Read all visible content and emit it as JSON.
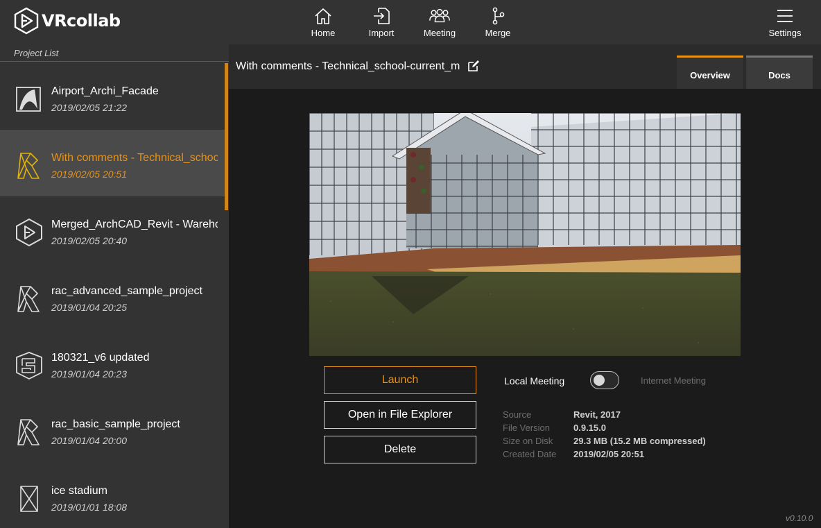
{
  "app": {
    "name": "VRcollab",
    "version": "v0.10.0"
  },
  "nav": {
    "home": "Home",
    "import": "Import",
    "meeting": "Meeting",
    "merge": "Merge",
    "settings": "Settings"
  },
  "sidebar": {
    "title": "Project List",
    "items": [
      {
        "name": "Airport_Archi_Facade",
        "date": "2019/02/05 21:22",
        "icon": "archicad-icon",
        "selected": false
      },
      {
        "name": "With comments - Technical_school-current_m",
        "date": "2019/02/05 20:51",
        "icon": "revit-icon",
        "selected": true
      },
      {
        "name": "Merged_ArchCAD_Revit - Warehouse",
        "date": "2019/02/05 20:40",
        "icon": "vrcollab-icon",
        "selected": false
      },
      {
        "name": "rac_advanced_sample_project",
        "date": "2019/01/04 20:25",
        "icon": "revit-icon",
        "selected": false
      },
      {
        "name": "180321_v6 updated",
        "date": "2019/01/04 20:23",
        "icon": "sketchup-icon",
        "selected": false
      },
      {
        "name": "rac_basic_sample_project",
        "date": "2019/01/04 20:00",
        "icon": "revit-icon",
        "selected": false
      },
      {
        "name": "ice stadium",
        "date": "2019/01/01 18:08",
        "icon": "navisworks-icon",
        "selected": false
      }
    ]
  },
  "main": {
    "title": "With comments - Technical_school-current_m",
    "tabs": [
      {
        "label": "Overview",
        "active": true
      },
      {
        "label": "Docs",
        "active": false
      }
    ],
    "buttons": {
      "launch": "Launch",
      "open_explorer": "Open in File Explorer",
      "delete": "Delete"
    },
    "meeting": {
      "local_label": "Local Meeting",
      "internet_label": "Internet Meeting",
      "internet_enabled": false
    },
    "info": [
      {
        "label": "Source",
        "value": "Revit, 2017"
      },
      {
        "label": "File Version",
        "value": "0.9.15.0"
      },
      {
        "label": "Size on Disk",
        "value": "29.3 MB (15.2 MB compressed)"
      },
      {
        "label": "Created Date",
        "value": "2019/02/05 20:51"
      }
    ]
  },
  "colors": {
    "accent": "#e89216",
    "sidebar_bg": "#333333",
    "main_bg": "#1b1b1b"
  }
}
